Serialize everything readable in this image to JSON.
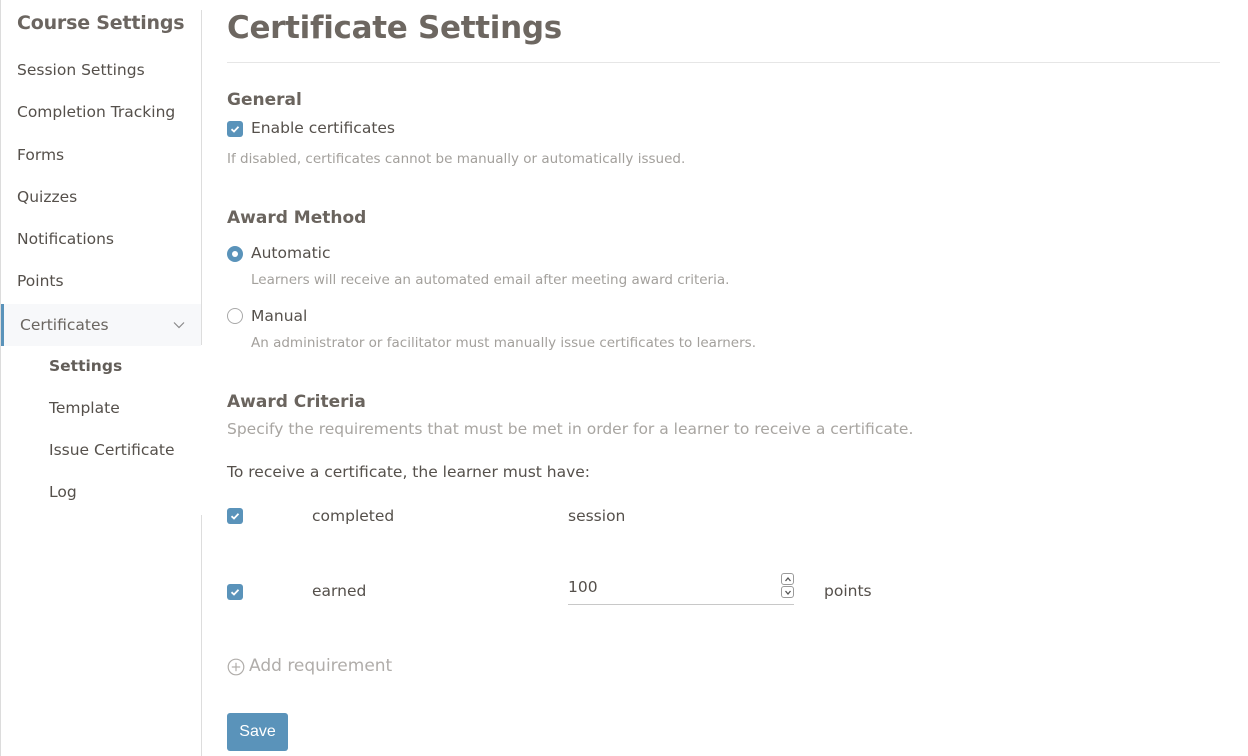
{
  "sidebar": {
    "title": "Course Settings",
    "items": [
      {
        "label": "Session Settings"
      },
      {
        "label": "Completion Tracking"
      },
      {
        "label": "Forms"
      },
      {
        "label": "Quizzes"
      },
      {
        "label": "Notifications"
      },
      {
        "label": "Points"
      },
      {
        "label": "Certificates",
        "expanded": true,
        "icon": "chevron-down-icon"
      }
    ],
    "subitems": [
      {
        "label": "Settings",
        "current": true
      },
      {
        "label": "Template"
      },
      {
        "label": "Issue Certificate"
      },
      {
        "label": "Log"
      }
    ]
  },
  "page": {
    "title": "Certificate Settings"
  },
  "general": {
    "heading": "General",
    "enable_label": "Enable certificates",
    "enable_checked": true,
    "help": "If disabled, certificates cannot be manually or automatically issued."
  },
  "award_method": {
    "heading": "Award Method",
    "options": [
      {
        "label": "Automatic",
        "checked": true,
        "help": "Learners will receive an automated email after meeting award criteria."
      },
      {
        "label": "Manual",
        "checked": false,
        "help": "An administrator or facilitator must manually issue certificates to learners."
      }
    ]
  },
  "award_criteria": {
    "heading": "Award Criteria",
    "help": "Specify the requirements that must be met in order for a learner to receive a certificate.",
    "intro": "To receive a certificate, the learner must have:",
    "requirements": [
      {
        "checked": true,
        "verb": "completed",
        "target": "session"
      },
      {
        "checked": true,
        "verb": "earned",
        "value": "100",
        "unit": "points"
      }
    ],
    "add_label": "Add requirement"
  },
  "actions": {
    "save_label": "Save"
  },
  "colors": {
    "accent": "#5a93ba",
    "text": "#55504b",
    "muted": "#a3a09c"
  }
}
